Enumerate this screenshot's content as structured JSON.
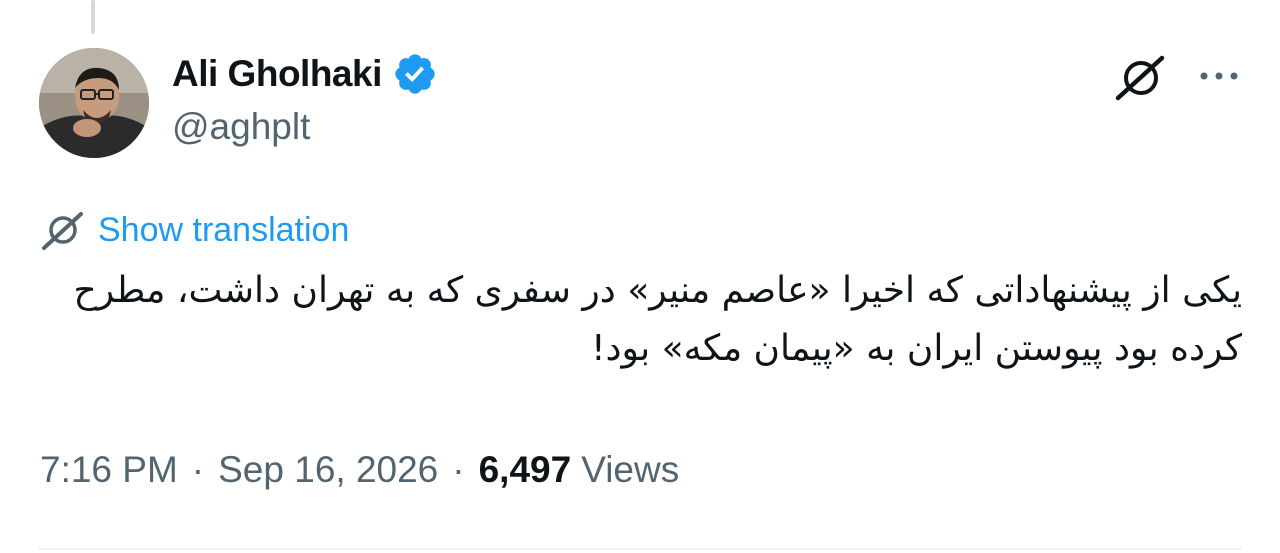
{
  "author": {
    "display_name": "Ali Gholhaki",
    "handle": "@aghplt",
    "verified": true
  },
  "icons": {
    "verified": "verified-badge-icon",
    "grok": "grok-icon",
    "more": "more-options-icon",
    "translate": "translate-icon"
  },
  "translation": {
    "label": "Show translation"
  },
  "tweet": {
    "text": "یکی از پیشنهاداتی که اخیرا «عاصم منیر» در سفری که به تهران داشت، مطرح کرده بود پیوستن ایران به «پیمان مکه» بود!"
  },
  "meta": {
    "time": "7:16 PM",
    "separator": "·",
    "date": "Sep 16, 2026",
    "views_count": "6,497",
    "views_label": "Views"
  },
  "colors": {
    "accent": "#1d9bf0",
    "text_primary": "#0f1419",
    "text_secondary": "#536471",
    "verified": "#1d9bf0"
  }
}
